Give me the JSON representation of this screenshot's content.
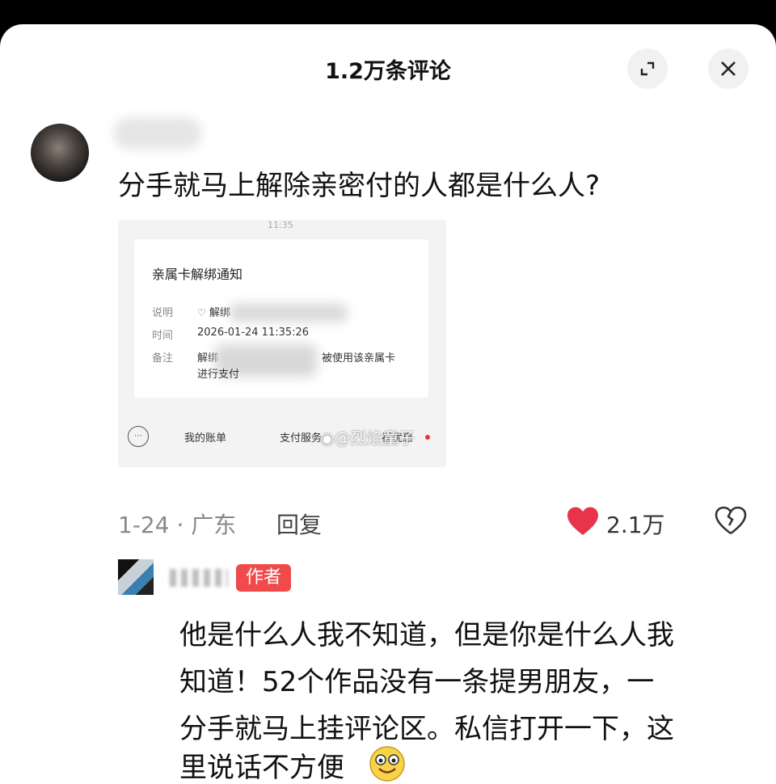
{
  "header": {
    "title": "1.2万条评论"
  },
  "comment": {
    "text": "分手就马上解除亲密付的人都是什么人?",
    "meta_date": "1-24 · 广东",
    "reply_label": "回复",
    "like_count": "2.1万"
  },
  "screenshot": {
    "status_time": "11:35",
    "card_title": "亲属卡解绑通知",
    "rows": [
      {
        "label": "说明",
        "value": "解绑"
      },
      {
        "label": "时间",
        "value": "2026-01-24 11:35:26"
      },
      {
        "label": "备注",
        "value": "解绑"
      }
    ],
    "note_tail": "被使用该亲属卡",
    "note_line2": "进行支付",
    "tabs": [
      "我的账单",
      "支付服务",
      "福优惠"
    ],
    "watermark": "@烈焰童子"
  },
  "reply": {
    "badge": "作者",
    "lines": [
      "他是什么人我不知道，但是你是什么人我",
      "知道！52个作品没有一条提男朋友，一",
      "分手就马上挂评论区。私信打开一下，这",
      "里说话不方便"
    ]
  },
  "colors": {
    "like_red": "#e8344a",
    "badge_red": "#f04a4a",
    "text_gray": "#888888"
  }
}
